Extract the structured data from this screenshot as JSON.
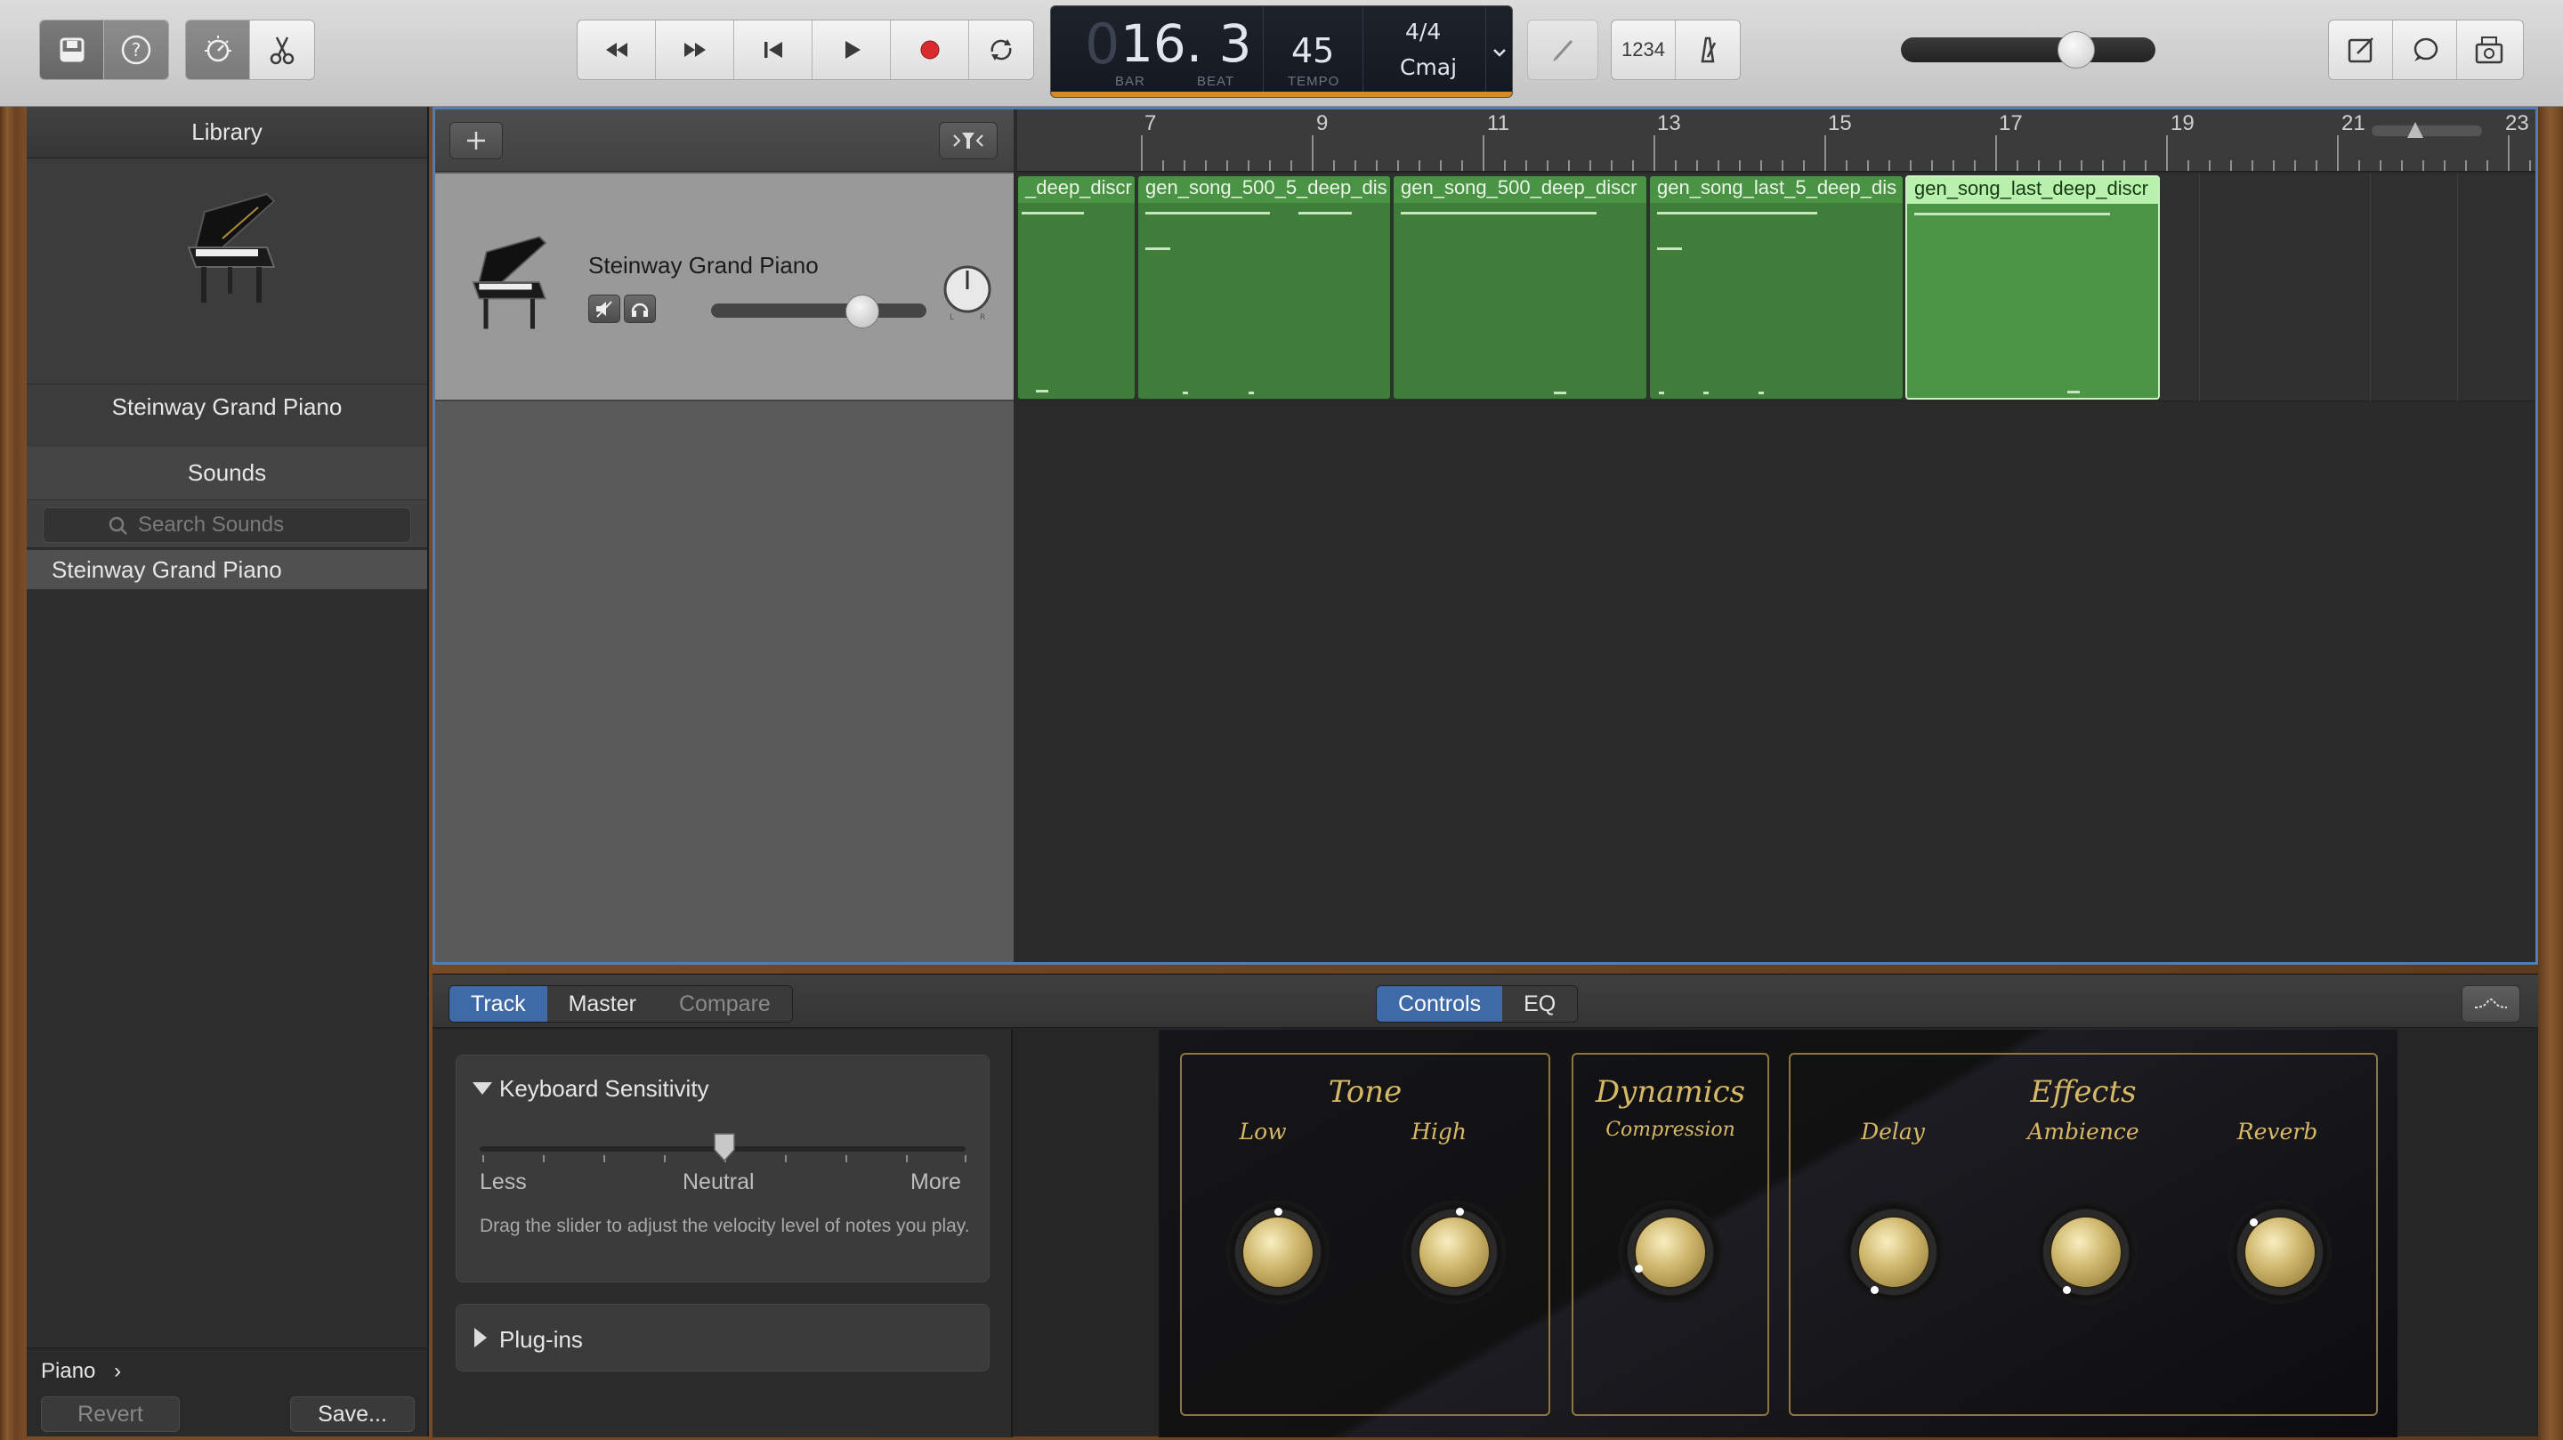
{
  "toolbar": {
    "left_icons": [
      "library-icon",
      "help-icon",
      "smart-controls-icon",
      "scissors-icon"
    ],
    "transport_icons": [
      "rewind-icon",
      "fast-forward-icon",
      "go-to-start-icon",
      "play-icon",
      "record-icon",
      "cycle-icon"
    ],
    "lcd": {
      "position": "16. 3",
      "bar_label": "BAR",
      "beat_label": "BEAT",
      "tempo": "45",
      "tempo_label": "TEMPO",
      "signature": "4/4",
      "key": "Cmaj"
    },
    "count_in": "1234",
    "master_volume": 0.62,
    "record_color": "#d92b2b",
    "lcd_accent": "#d88a2a"
  },
  "library": {
    "title": "Library",
    "preview_name": "Steinway Grand Piano",
    "sounds_header": "Sounds",
    "search_placeholder": "Search Sounds",
    "items": [
      {
        "label": "Steinway Grand Piano"
      }
    ],
    "breadcrumb": "Piano",
    "revert_label": "Revert",
    "save_label": "Save..."
  },
  "tracks": {
    "ruler_marks": [
      "7",
      "9",
      "11",
      "13",
      "15",
      "17",
      "19",
      "21",
      "23"
    ],
    "track": {
      "name": "Steinway Grand Piano",
      "volume": 0.68
    },
    "regions": [
      {
        "name": "_deep_discr",
        "selected": false
      },
      {
        "name": "gen_song_500_5_deep_dis",
        "selected": false
      },
      {
        "name": "gen_song_500_deep_discr",
        "selected": false
      },
      {
        "name": "gen_song_last_5_deep_dis",
        "selected": false
      },
      {
        "name": "gen_song_last_deep_discr",
        "selected": true
      }
    ],
    "region_color": "#3f7d3a"
  },
  "editor": {
    "tabs_left": {
      "track": "Track",
      "master": "Master",
      "compare": "Compare"
    },
    "tabs_center": {
      "controls": "Controls",
      "eq": "EQ"
    },
    "keyboard": {
      "title": "Keyboard Sensitivity",
      "less": "Less",
      "neutral": "Neutral",
      "more": "More",
      "value": 0.5,
      "help": "Drag the slider to adjust the velocity level of notes you play."
    },
    "plugins_title": "Plug-ins",
    "amp": {
      "tone_title": "Tone",
      "low": "Low",
      "high": "High",
      "dynamics_title": "Dynamics",
      "compression": "Compression",
      "effects_title": "Effects",
      "delay": "Delay",
      "ambience": "Ambience",
      "reverb": "Reverb"
    }
  }
}
